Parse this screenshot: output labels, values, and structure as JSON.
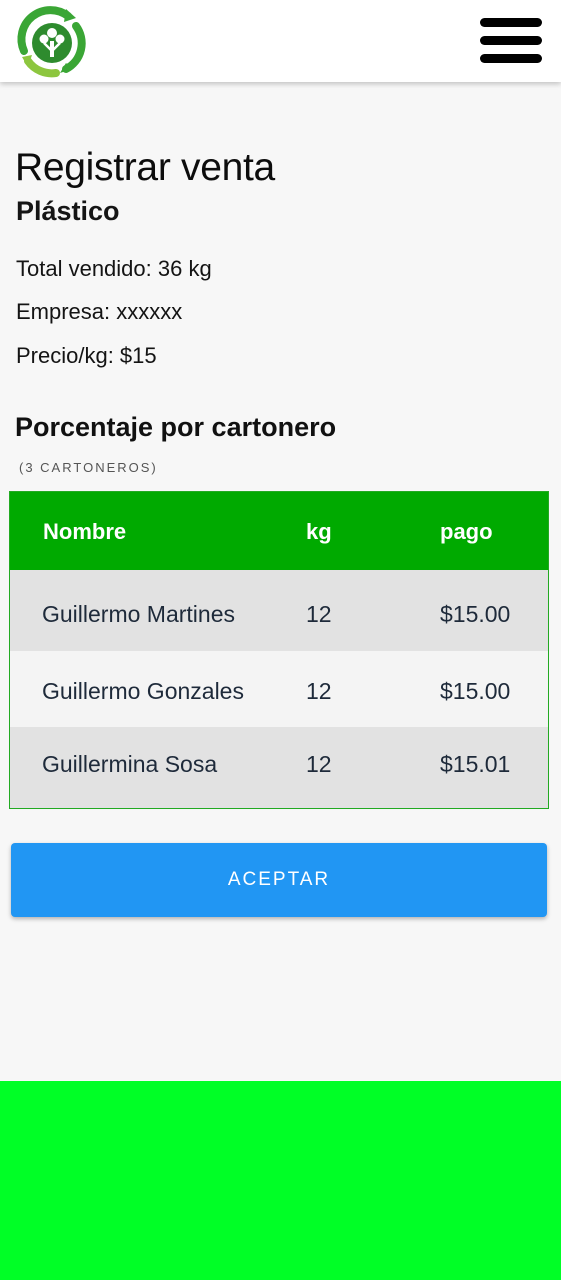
{
  "header": {
    "logo_icon": "recycling-tree-logo",
    "menu_icon": "hamburger-menu-icon"
  },
  "page": {
    "title": "Registrar venta",
    "material": "Plástico",
    "total_sold": "Total vendido: 36 kg",
    "company": "Empresa: xxxxxx",
    "price_per_kg": "Precio/kg: $15"
  },
  "section": {
    "title": "Porcentaje por cartonero",
    "caption": "(3 CARTONEROS)"
  },
  "table": {
    "headers": {
      "name": "Nombre",
      "kg": "kg",
      "payment": "pago"
    },
    "rows": [
      {
        "name": "Guillermo Martines",
        "kg": "12",
        "payment": "$15.00"
      },
      {
        "name": "Guillermo Gonzales",
        "kg": "12",
        "payment": "$15.00"
      },
      {
        "name": "Guillermina Sosa",
        "kg": "12",
        "payment": "$15.01"
      }
    ]
  },
  "actions": {
    "accept_label": "ACEPTAR"
  },
  "colors": {
    "header_green": "#00aa00",
    "button_blue": "#2196f3",
    "footer_green": "#00ff26",
    "logo_green": "#3aa635"
  }
}
